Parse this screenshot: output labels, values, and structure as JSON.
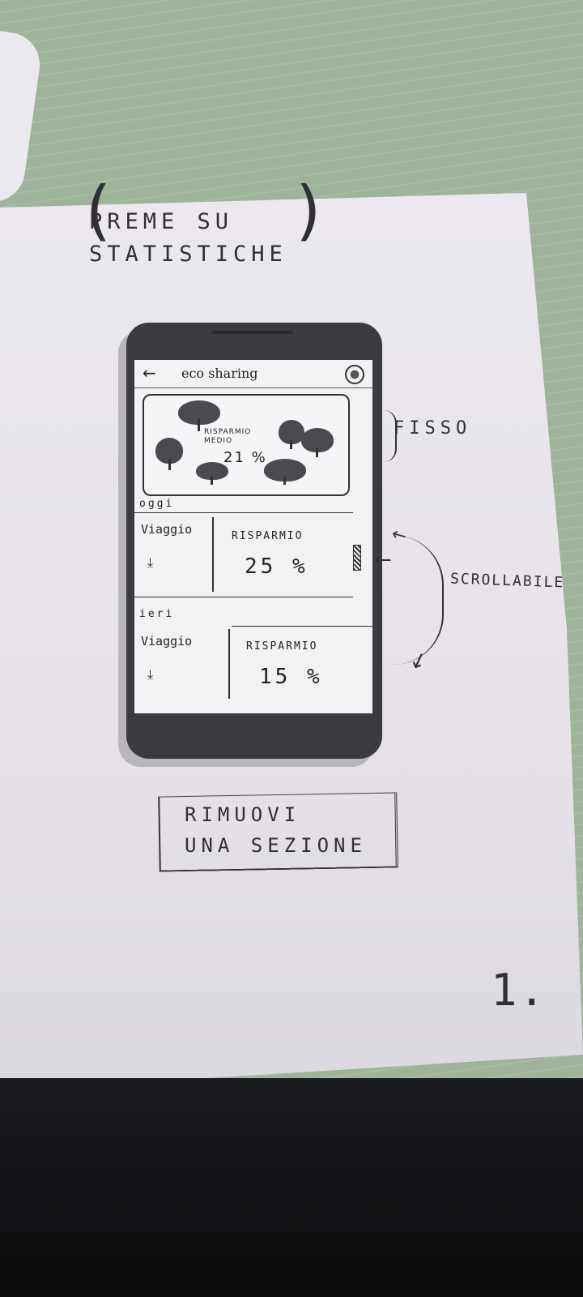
{
  "note": {
    "title_line1": "PREME SU",
    "title_line2": "STATISTICHE",
    "fixed": "FISSO",
    "scrollable": "SCROLLABILE",
    "remove_line1": "RIMUOVI",
    "remove_line2": "UNA SEZIONE",
    "page_number": "1."
  },
  "app": {
    "back_icon": "arrow-left-icon",
    "title": "eco sharing",
    "logo_icon": "eco-logo-icon"
  },
  "stats": {
    "label_line1": "RISPARMIO",
    "label_line2": "MEDIO",
    "value": "21 %"
  },
  "sections": [
    {
      "day": "oggi",
      "trip_label": "Viaggio",
      "saving_label": "RISPARMIO",
      "saving_value": "25 %"
    },
    {
      "day": "ieri",
      "trip_label": "Viaggio",
      "saving_label": "RISPARMIO",
      "saving_value": "15 %"
    }
  ]
}
